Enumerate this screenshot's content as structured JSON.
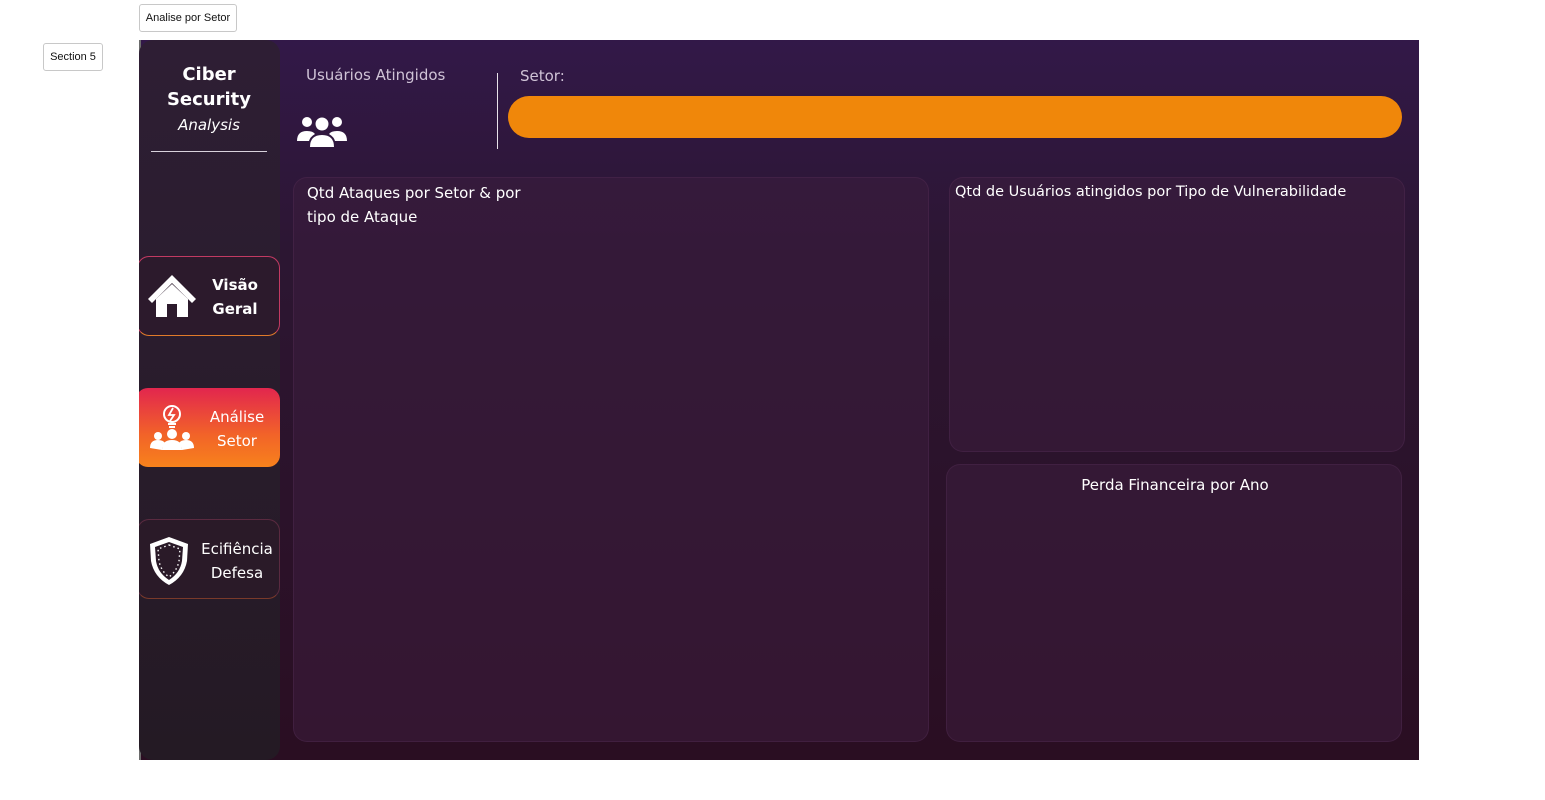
{
  "tabs": {
    "page_tab": "Analise por Setor",
    "section_tab": "Section 5"
  },
  "brand": {
    "line1": "Ciber",
    "line2": "Security",
    "line3": "Analysis"
  },
  "nav": {
    "overview": {
      "line1": "Visão",
      "line2": "Geral",
      "icon": "home-icon"
    },
    "sector": {
      "line1": "Análise",
      "line2": "Setor",
      "icon": "team-idea-icon"
    },
    "defense": {
      "line1": "Ecifiência",
      "line2": "Defesa",
      "icon": "shield-icon"
    }
  },
  "header": {
    "users_title": "Usuários Atingidos",
    "users_icon": "users-icon",
    "setor_label": "Setor:",
    "setor_value": ""
  },
  "panels": {
    "attacks_title": "Qtd Ataques por Setor & por tipo de Ataque",
    "vuln_title": "Qtd de Usuários atingidos por Tipo de Vulnerabilidade",
    "loss_title": "Perda Financeira por Ano"
  },
  "colors": {
    "accent": "#f0870a",
    "active_nav_start": "#e2264e",
    "active_nav_end": "#f7821c",
    "background": "#2c1632"
  }
}
